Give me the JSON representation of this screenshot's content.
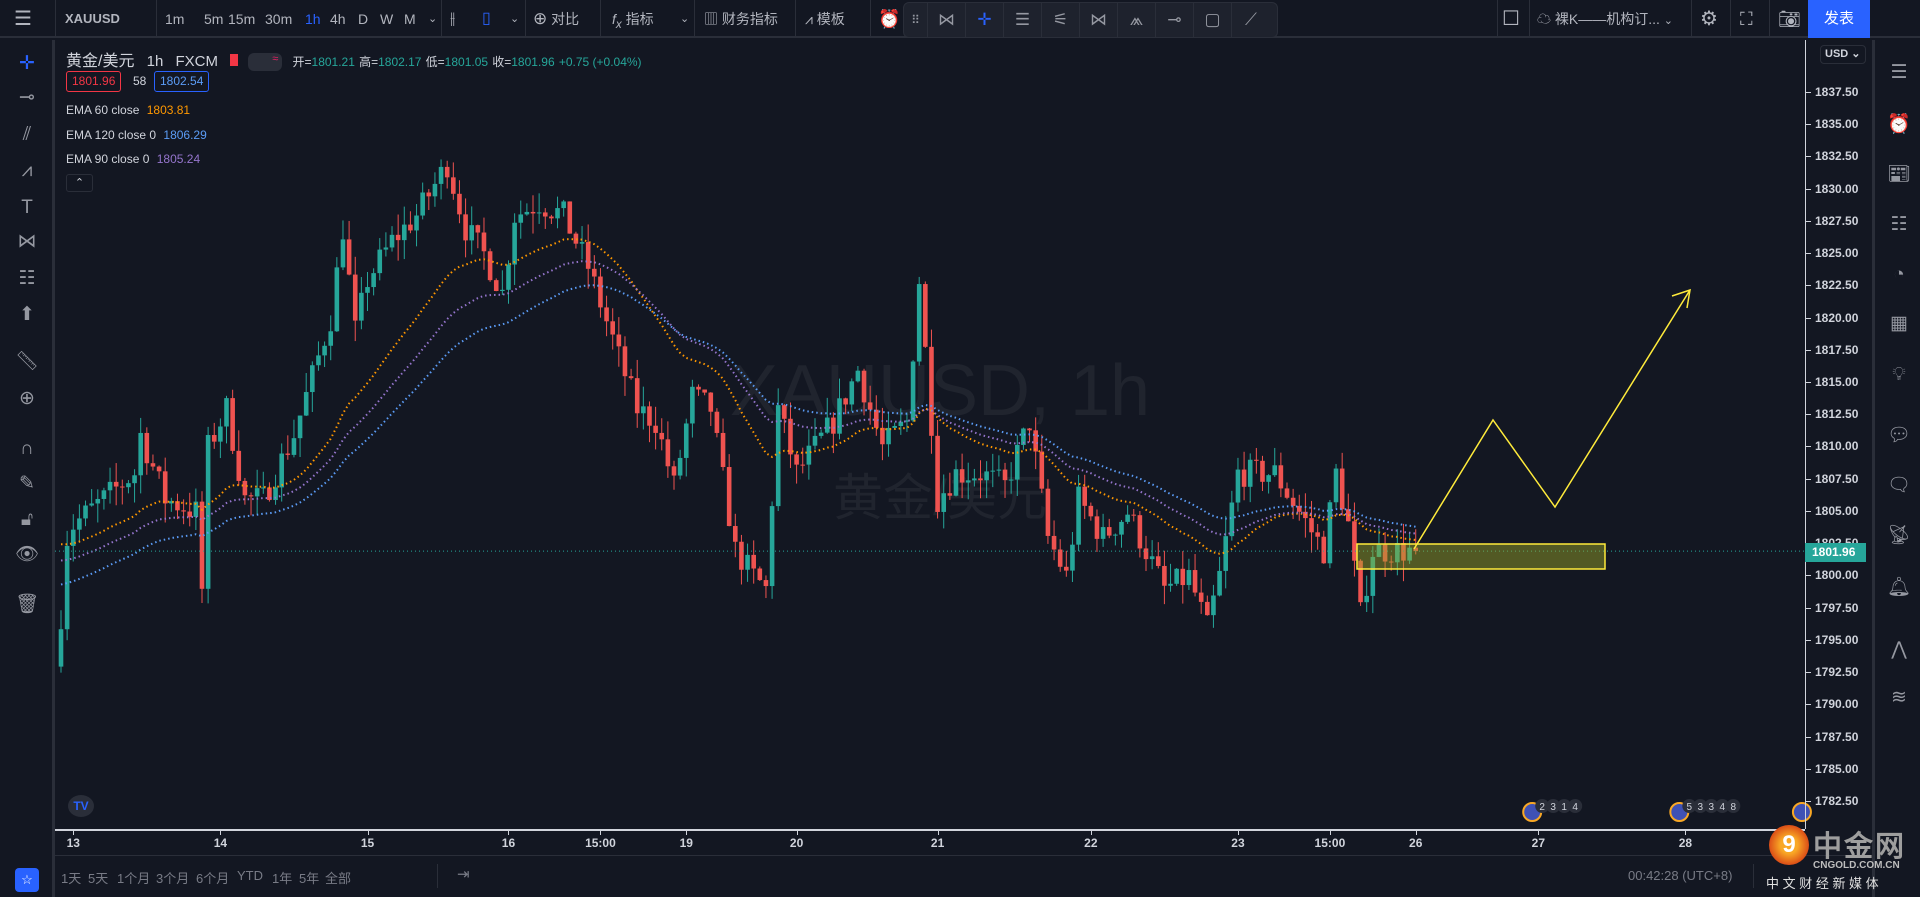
{
  "topbar": {
    "symbol": "XAUUSD",
    "intervals": [
      "1m",
      "5m",
      "15m",
      "30m",
      "1h",
      "4h",
      "D",
      "W",
      "M"
    ],
    "active_interval": "1h",
    "compare": "对比",
    "indicators": "指标",
    "financials": "财务指标",
    "templates": "模板",
    "layout_name": "裸K——机构订...",
    "publish": "发表"
  },
  "legend": {
    "title": "黄金/美元",
    "interval": "1h",
    "exchange": "FXCM",
    "open_label": "开=",
    "open": "1801.21",
    "high_label": "高=",
    "high": "1802.17",
    "low_label": "低=",
    "low": "1801.05",
    "close_label": "收=",
    "close": "1801.96",
    "change": "+0.75 (+0.04%)",
    "bid": "1801.96",
    "spread": "58",
    "ask": "1802.54",
    "ema": [
      {
        "name": "EMA 60 close",
        "value": "1803.81",
        "color": "#ff9800"
      },
      {
        "name": "EMA 120 close 0",
        "value": "1806.29",
        "color": "#5b9cf6"
      },
      {
        "name": "EMA 90 close 0",
        "value": "1805.24",
        "color": "#9575cd"
      }
    ]
  },
  "watermark": {
    "line1": "XAUUSD, 1h",
    "line2": "黄金/美元"
  },
  "currency": "USD",
  "current_price": "1801.96",
  "price_ticks": [
    "1837.50",
    "1835.00",
    "1832.50",
    "1830.00",
    "1827.50",
    "1825.00",
    "1822.50",
    "1820.00",
    "1817.50",
    "1815.00",
    "1812.50",
    "1810.00",
    "1807.50",
    "1805.00",
    "1802.50",
    "1800.00",
    "1797.50",
    "1795.00",
    "1792.50",
    "1790.00",
    "1787.50",
    "1785.00",
    "1782.50"
  ],
  "time_ticks": [
    {
      "label": "13",
      "bar": 2
    },
    {
      "label": "14",
      "bar": 26
    },
    {
      "label": "15",
      "bar": 50
    },
    {
      "label": "16",
      "bar": 73
    },
    {
      "label": "15:00",
      "bar": 88
    },
    {
      "label": "19",
      "bar": 102
    },
    {
      "label": "20",
      "bar": 120
    },
    {
      "label": "21",
      "bar": 143
    },
    {
      "label": "22",
      "bar": 168
    },
    {
      "label": "23",
      "bar": 192
    },
    {
      "label": "15:00",
      "bar": 207
    },
    {
      "label": "26",
      "bar": 221
    },
    {
      "label": "27",
      "bar": 241
    },
    {
      "label": "28",
      "bar": 265
    }
  ],
  "events": [
    {
      "bar": 240,
      "labels": [
        "2",
        "3",
        "1",
        "4"
      ]
    },
    {
      "bar": 264,
      "labels": [
        "5",
        "3",
        "3",
        "4",
        "8"
      ]
    },
    {
      "bar": 284,
      "labels": []
    }
  ],
  "bottombar": {
    "ranges": [
      "1天",
      "5天",
      "1个月",
      "3个月",
      "6个月",
      "YTD",
      "1年",
      "5年",
      "全部"
    ],
    "clock": "00:42:28 (UTC+8)"
  },
  "logo": {
    "name": "中金网",
    "domain": "CNGOLD.COM.CN",
    "slogan": "中 文 财 经 新 媒 体"
  },
  "colors": {
    "up": "#26a69a",
    "down": "#ef5350",
    "accent": "#2962ff",
    "drawing": "#ffeb3b"
  },
  "chart_data": {
    "type": "candlestick",
    "symbol": "XAUUSD",
    "interval": "1h",
    "bars": 222,
    "ylim": [
      1780,
      1840
    ],
    "close_path": [
      [
        0,
        1797
      ],
      [
        1,
        1803
      ],
      [
        2,
        1804
      ],
      [
        12,
        1808
      ],
      [
        13,
        1811
      ],
      [
        17,
        1806
      ],
      [
        22,
        1805
      ],
      [
        23,
        1799
      ],
      [
        24,
        1810
      ],
      [
        27,
        1813
      ],
      [
        30,
        1806
      ],
      [
        33,
        1806
      ],
      [
        38,
        1811
      ],
      [
        44,
        1820
      ],
      [
        46,
        1827
      ],
      [
        48,
        1819
      ],
      [
        50,
        1823
      ],
      [
        54,
        1826
      ],
      [
        58,
        1828
      ],
      [
        63,
        1832
      ],
      [
        66,
        1827
      ],
      [
        69,
        1825
      ],
      [
        72,
        1822
      ],
      [
        74,
        1828
      ],
      [
        78,
        1829
      ],
      [
        82,
        1828
      ],
      [
        86,
        1824
      ],
      [
        91,
        1817
      ],
      [
        94,
        1813
      ],
      [
        97,
        1812
      ],
      [
        100,
        1807
      ],
      [
        103,
        1814
      ],
      [
        106,
        1813
      ],
      [
        110,
        1802
      ],
      [
        113,
        1800
      ],
      [
        115,
        1799
      ],
      [
        117,
        1813
      ],
      [
        120,
        1808
      ],
      [
        123,
        1810
      ],
      [
        126,
        1812
      ],
      [
        130,
        1816
      ],
      [
        134,
        1810
      ],
      [
        138,
        1812
      ],
      [
        140,
        1823
      ],
      [
        142,
        1812
      ],
      [
        143,
        1806
      ],
      [
        146,
        1808
      ],
      [
        150,
        1808
      ],
      [
        154,
        1807
      ],
      [
        158,
        1812
      ],
      [
        161,
        1803
      ],
      [
        164,
        1800
      ],
      [
        166,
        1806
      ],
      [
        170,
        1803
      ],
      [
        174,
        1805
      ],
      [
        178,
        1801
      ],
      [
        180,
        1799
      ],
      [
        184,
        1800
      ],
      [
        187,
        1796
      ],
      [
        189,
        1800
      ],
      [
        192,
        1808
      ],
      [
        198,
        1808
      ],
      [
        202,
        1805
      ],
      [
        206,
        1802
      ],
      [
        208,
        1808
      ],
      [
        210,
        1804
      ],
      [
        212,
        1797
      ],
      [
        214,
        1802
      ],
      [
        217,
        1802
      ],
      [
        221,
        1801.96
      ]
    ],
    "ema_start": {
      "ema60": 1803,
      "ema90": 1801.5,
      "ema120": 1799.5
    }
  }
}
